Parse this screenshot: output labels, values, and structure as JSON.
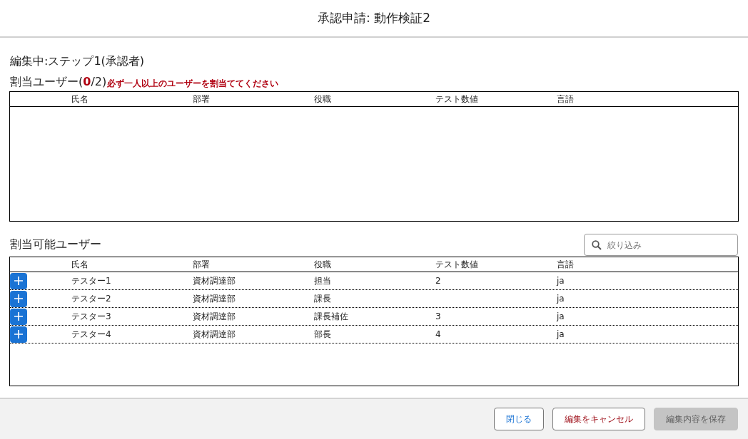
{
  "window": {
    "title": "承認申請: 動作検証2"
  },
  "editing_label": "編集中:ステップ1(承認者)",
  "assigned": {
    "heading": "割当ユーザー(**0**/2)",
    "warning": "必ず一人以上のユーザーを割当ててください",
    "columns": [
      "氏名",
      "部署",
      "役職",
      "テスト数値",
      "言語"
    ]
  },
  "available": {
    "heading": "割当可能ユーザー",
    "search": {
      "placeholder": "絞り込み"
    },
    "columns": [
      "氏名",
      "部署",
      "役職",
      "テスト数値",
      "言語"
    ],
    "rows": [
      {
        "cells": [
          "テスター1",
          "資材調達部",
          "担当",
          "2",
          "ja"
        ]
      },
      {
        "cells": [
          "テスター2",
          "資材調達部",
          "課長",
          "",
          "ja"
        ]
      },
      {
        "cells": [
          "テスター3",
          "資材調達部",
          "課長補佐",
          "3",
          "ja"
        ]
      },
      {
        "cells": [
          "テスター4",
          "資材調達部",
          "部長",
          "4",
          "ja"
        ]
      }
    ]
  },
  "buttons": [
    {
      "label": "閉じる",
      "kind": "close",
      "disabled": false
    },
    {
      "label": "編集をキャンセル",
      "kind": "cancel",
      "disabled": false
    },
    {
      "label": "編集内容を保存",
      "kind": "save",
      "disabled": true
    }
  ]
}
